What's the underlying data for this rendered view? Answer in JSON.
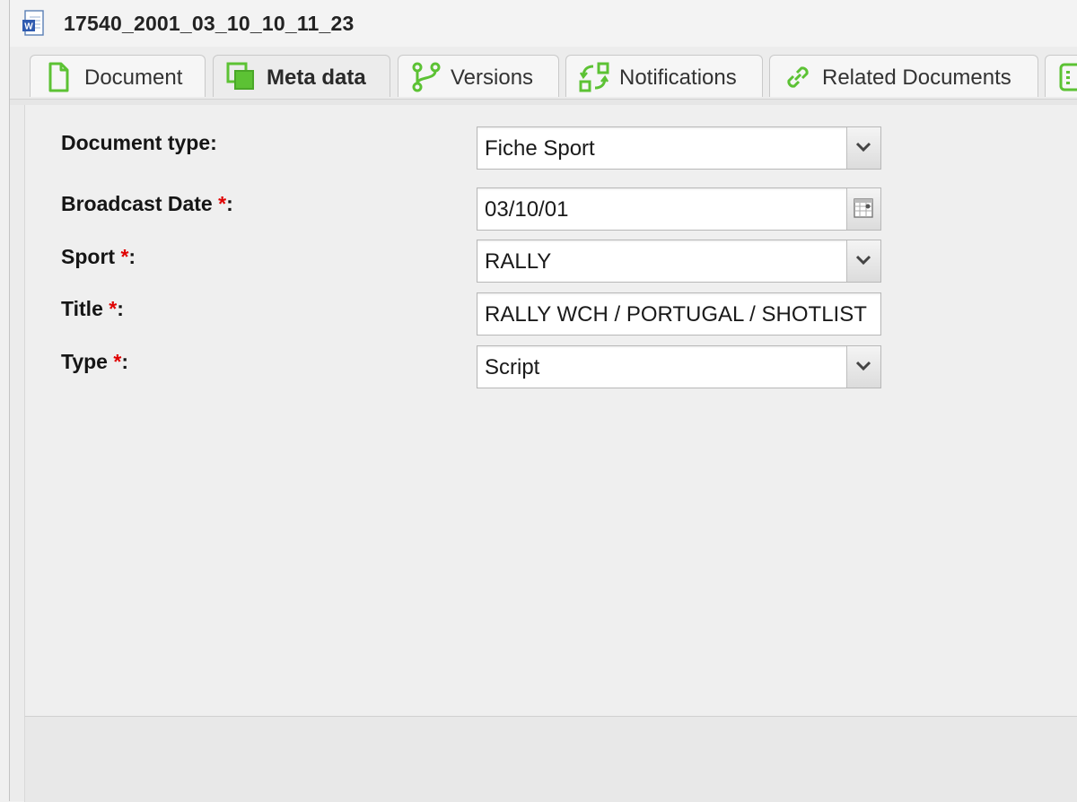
{
  "window": {
    "title": "17540_2001_03_10_10_11_23"
  },
  "tabs": [
    {
      "label": "Document",
      "icon": "document-icon",
      "active": false
    },
    {
      "label": "Meta data",
      "icon": "meta-data-icon",
      "active": true
    },
    {
      "label": "Versions",
      "icon": "versions-branch-icon",
      "active": false
    },
    {
      "label": "Notifications",
      "icon": "notifications-arrows-icon",
      "active": false
    },
    {
      "label": "Related Documents",
      "icon": "link-icon",
      "active": false
    }
  ],
  "form": {
    "document_type": {
      "label": "Document type:",
      "value": "Fiche Sport"
    },
    "broadcast_date": {
      "label": "Broadcast Date ",
      "required_mark": "*",
      "suffix": ":",
      "value": "03/10/01"
    },
    "sport": {
      "label": "Sport ",
      "required_mark": "*",
      "suffix": ":",
      "value": "RALLY"
    },
    "title": {
      "label": "Title ",
      "required_mark": "*",
      "suffix": ":",
      "value": "RALLY WCH / PORTUGAL / SHOTLIST"
    },
    "type": {
      "label": "Type ",
      "required_mark": "*",
      "suffix": ":",
      "value": "Script"
    }
  },
  "colors": {
    "accent_green": "#5cc234",
    "required": "#e00000"
  }
}
